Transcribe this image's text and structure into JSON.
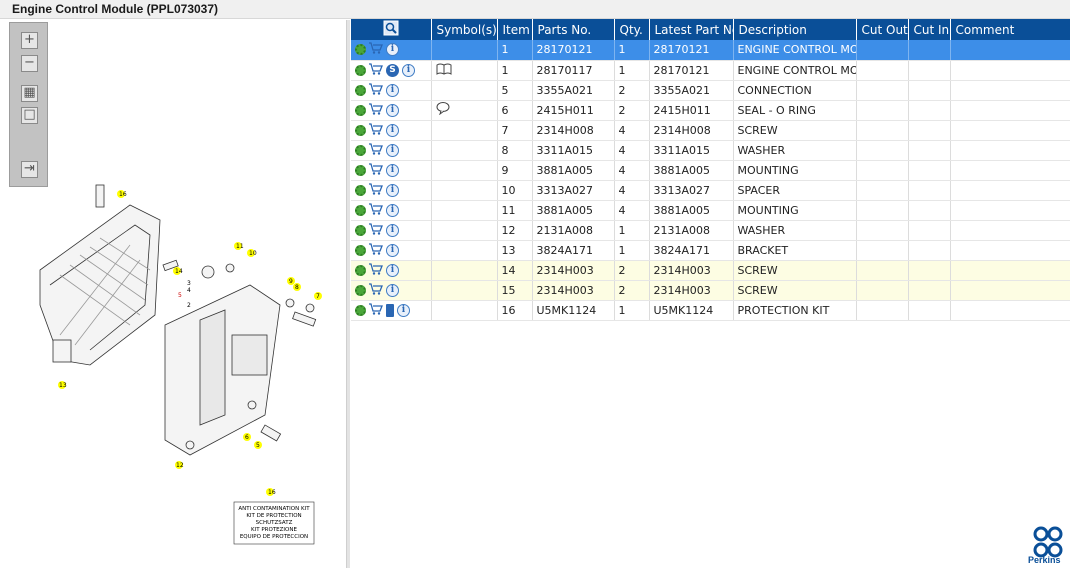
{
  "window": {
    "title": "Engine Control Module (PPL073037)"
  },
  "columns": {
    "symbols": "Symbol(s)",
    "item": "Item",
    "parts_no": "Parts No.",
    "qty": "Qty.",
    "latest_part_no": "Latest Part No.",
    "description": "Description",
    "cut_out": "Cut Out",
    "cut_in": "Cut In",
    "comment": "Comment"
  },
  "rows": [
    {
      "item": "1",
      "parts_no": "28170121",
      "qty": "1",
      "latest": "28170121",
      "desc": "ENGINE CONTROL MODULE",
      "icons": [
        "gear-group",
        "cart",
        "info"
      ]
    },
    {
      "item": "1",
      "parts_no": "28170117",
      "qty": "1",
      "latest": "28170121",
      "desc": "ENGINE CONTROL MODULE",
      "icons": [
        "gear-group",
        "cart",
        "s",
        "info"
      ]
    },
    {
      "item": "5",
      "parts_no": "3355A021",
      "qty": "2",
      "latest": "3355A021",
      "desc": "CONNECTION",
      "icons": [
        "gear",
        "cart",
        "info"
      ]
    },
    {
      "item": "6",
      "parts_no": "2415H011",
      "qty": "2",
      "latest": "2415H011",
      "desc": "SEAL - O RING",
      "icons": [
        "gear",
        "cart",
        "info"
      ]
    },
    {
      "item": "7",
      "parts_no": "2314H008",
      "qty": "4",
      "latest": "2314H008",
      "desc": "SCREW",
      "icons": [
        "gear",
        "cart",
        "info"
      ]
    },
    {
      "item": "8",
      "parts_no": "3311A015",
      "qty": "4",
      "latest": "3311A015",
      "desc": "WASHER",
      "icons": [
        "gear",
        "cart",
        "info"
      ]
    },
    {
      "item": "9",
      "parts_no": "3881A005",
      "qty": "4",
      "latest": "3881A005",
      "desc": "MOUNTING",
      "icons": [
        "gear",
        "cart",
        "info"
      ]
    },
    {
      "item": "10",
      "parts_no": "3313A027",
      "qty": "4",
      "latest": "3313A027",
      "desc": "SPACER",
      "icons": [
        "gear",
        "cart",
        "info"
      ]
    },
    {
      "item": "11",
      "parts_no": "3881A005",
      "qty": "4",
      "latest": "3881A005",
      "desc": "MOUNTING",
      "icons": [
        "gear",
        "cart",
        "info"
      ]
    },
    {
      "item": "12",
      "parts_no": "2131A008",
      "qty": "1",
      "latest": "2131A008",
      "desc": "WASHER",
      "icons": [
        "gear",
        "cart",
        "info"
      ]
    },
    {
      "item": "13",
      "parts_no": "3824A171",
      "qty": "1",
      "latest": "3824A171",
      "desc": "BRACKET",
      "icons": [
        "gear",
        "cart",
        "info"
      ]
    },
    {
      "item": "14",
      "parts_no": "2314H003",
      "qty": "2",
      "latest": "2314H003",
      "desc": "SCREW",
      "icons": [
        "gear",
        "cart",
        "info"
      ]
    },
    {
      "item": "15",
      "parts_no": "2314H003",
      "qty": "2",
      "latest": "2314H003",
      "desc": "SCREW",
      "icons": [
        "gear",
        "cart",
        "info"
      ]
    },
    {
      "item": "16",
      "parts_no": "U5MK1124",
      "qty": "1",
      "latest": "U5MK1124",
      "desc": "PROTECTION KIT",
      "icons": [
        "gear",
        "cart",
        "book",
        "info"
      ]
    }
  ],
  "diagram": {
    "callouts": [
      "16",
      "11",
      "10",
      "14",
      "9",
      "8",
      "7",
      "3",
      "4",
      "5",
      "2",
      "13",
      "6",
      "5",
      "12"
    ],
    "kit_label": "16",
    "kit_text": [
      "ANTI CONTAMINATION KIT",
      "KIT DE PROTECTION",
      "SCHUTZSATZ",
      "KIT PROTEZIONE",
      "EQUIPO DE PROTECCION"
    ]
  },
  "brand": {
    "name": "Perkins",
    "color": "#0a4f98"
  },
  "colors": {
    "header": "#0a4f98",
    "selected": "#3d8ee8",
    "highlight": "#fdfde3"
  }
}
